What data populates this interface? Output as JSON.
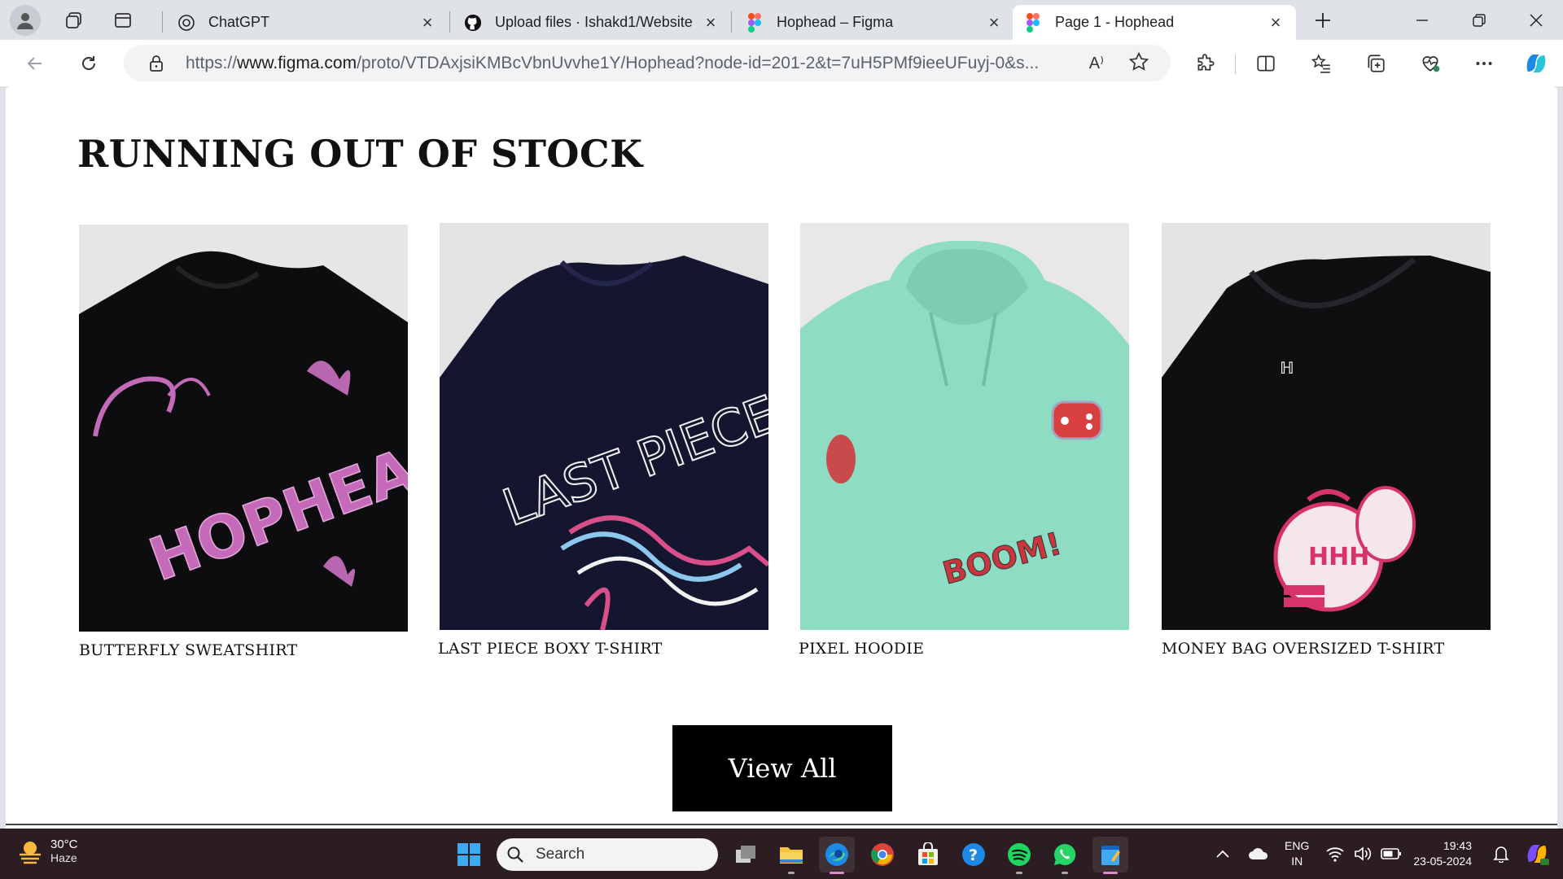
{
  "browser": {
    "tabs": [
      {
        "title": "ChatGPT",
        "icon": "chatgpt-icon"
      },
      {
        "title": "Upload files · Ishakd1/Website",
        "icon": "github-icon"
      },
      {
        "title": "Hophead – Figma",
        "icon": "figma-icon"
      },
      {
        "title": "Page 1 - Hophead",
        "icon": "figma-icon",
        "active": true
      }
    ],
    "url_prefix": "https://",
    "url_domain": "www.figma.com",
    "url_path": "/proto/VTDAxjsiKMBcVbnUvvhe1Y/Hophead?node-id=201-2&t=7uH5PMf9ieeUFuyj-0&s...",
    "read_aloud": "A⁾"
  },
  "page": {
    "section_title": "RUNNING OUT OF STOCK",
    "products": [
      {
        "name": "BUTTERFLY SWEATSHIRT",
        "print_text": "HOPHEAD"
      },
      {
        "name": "LAST PIECE BOXY T-SHIRT",
        "print_text": "LAST PIECE"
      },
      {
        "name": "PIXEL HOODIE",
        "print_text": "BOOM!"
      },
      {
        "name": "MONEY BAG OVERSIZED T-SHIRT",
        "print_text": "HHH"
      }
    ],
    "view_all_label": "View All"
  },
  "taskbar": {
    "weather_temp": "30°C",
    "weather_cond": "Haze",
    "search_placeholder": "Search",
    "lang_top": "ENG",
    "lang_bottom": "IN",
    "time": "19:43",
    "date": "23-05-2024"
  },
  "colors": {
    "accent": "#0b57d0",
    "taskbar_bg": "#2b1d22",
    "button_bg": "#000000"
  }
}
